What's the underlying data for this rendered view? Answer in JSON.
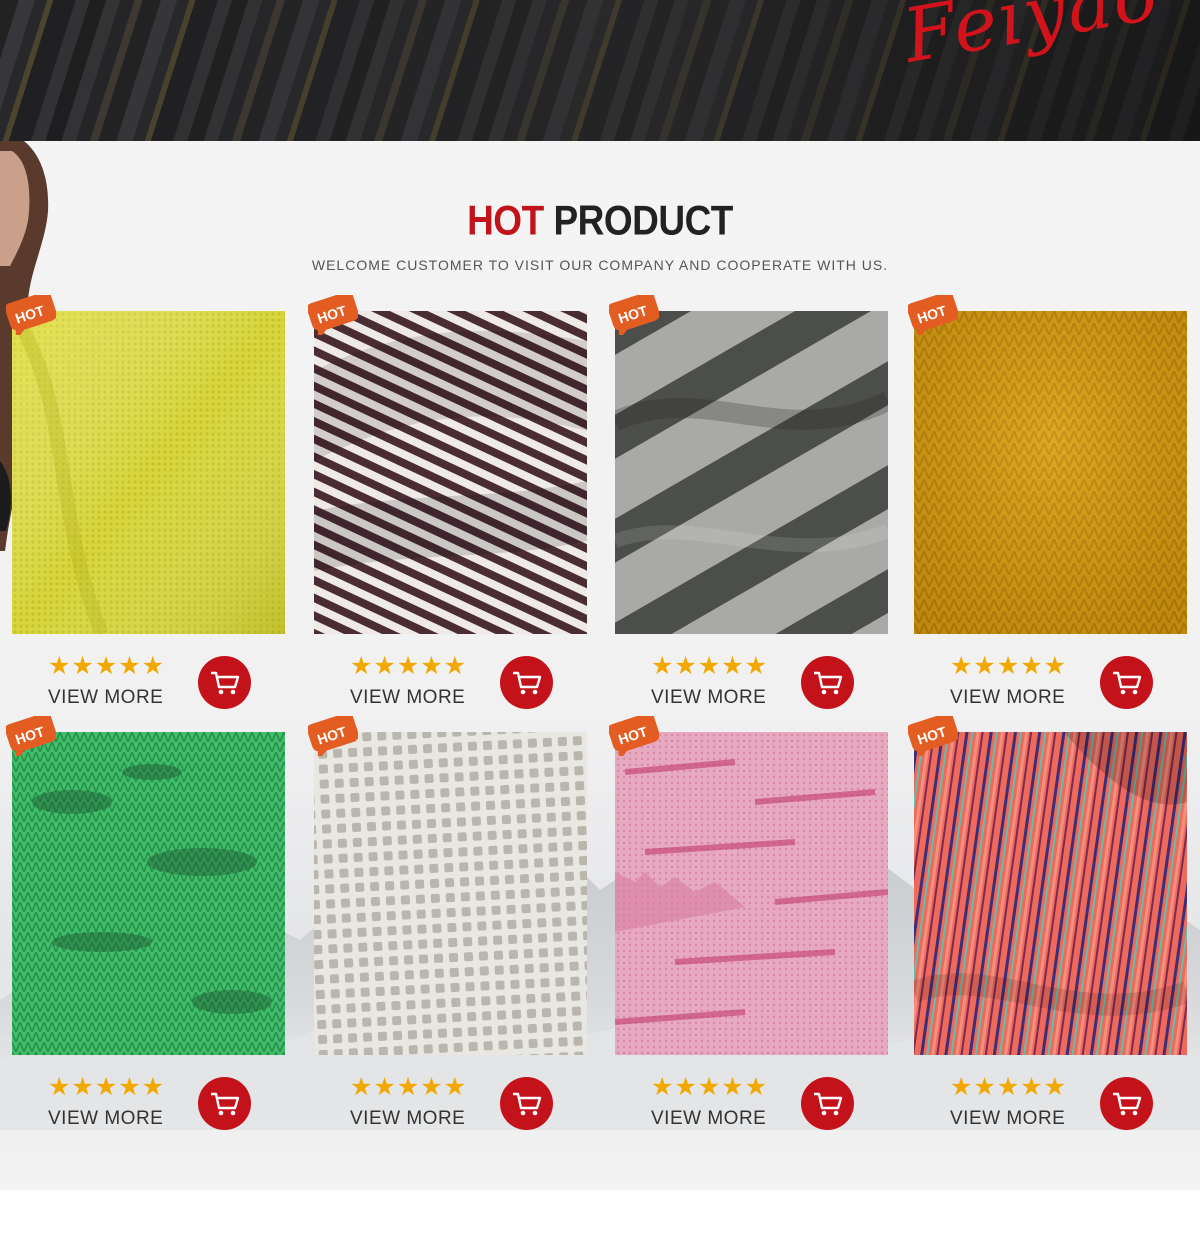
{
  "banner": {
    "brand_script": "Feiyao"
  },
  "section": {
    "title_hot": "HOT",
    "title_rest": "PRODUCT",
    "subtitle": "WELCOME CUSTOMER TO VISIT OUR COMPANY AND COOPERATE WITH US."
  },
  "colors": {
    "accent_red": "#c4121a",
    "star_gold": "#f1a800",
    "badge_orange": "#e35d22"
  },
  "products": [
    {
      "badge": "HOT",
      "stars": "★★★★★",
      "rating": 5,
      "link": "VIEW MORE",
      "swatch": "yellow-knit"
    },
    {
      "badge": "HOT",
      "stars": "★★★★★",
      "rating": 5,
      "link": "VIEW MORE",
      "swatch": "burgundy-white-stripe"
    },
    {
      "badge": "HOT",
      "stars": "★★★★★",
      "rating": 5,
      "link": "VIEW MORE",
      "swatch": "grey-wide-stripe"
    },
    {
      "badge": "HOT",
      "stars": "★★★★★",
      "rating": 5,
      "link": "VIEW MORE",
      "swatch": "mustard-knit"
    },
    {
      "badge": "HOT",
      "stars": "★★★★★",
      "rating": 5,
      "link": "VIEW MORE",
      "swatch": "green-melange"
    },
    {
      "badge": "HOT",
      "stars": "★★★★★",
      "rating": 5,
      "link": "VIEW MORE",
      "swatch": "white-waffle"
    },
    {
      "badge": "HOT",
      "stars": "★★★★★",
      "rating": 5,
      "link": "VIEW MORE",
      "swatch": "pink-space-dye"
    },
    {
      "badge": "HOT",
      "stars": "★★★★★",
      "rating": 5,
      "link": "VIEW MORE",
      "swatch": "multicolor-stripe"
    }
  ]
}
